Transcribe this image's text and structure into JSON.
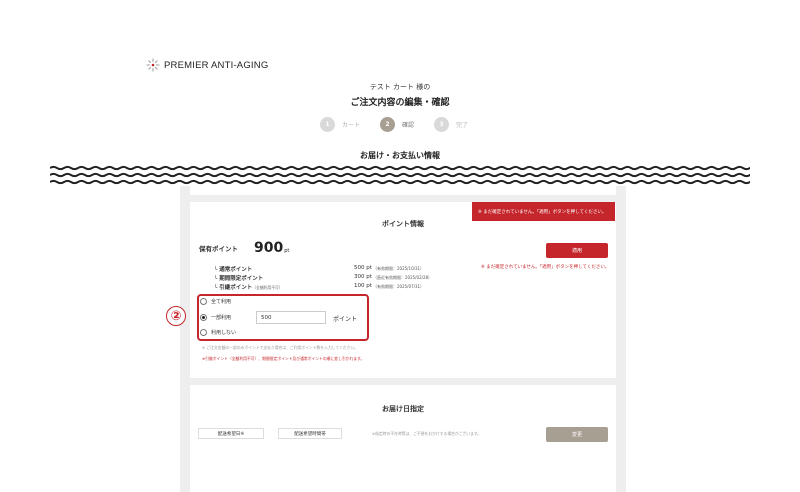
{
  "brand": {
    "logo_text": "PREMIER ANTI-AGING",
    "logo_icon": "sunburst-logo-icon"
  },
  "header": {
    "customer_line": "テスト カート 様の",
    "page_title": "ご注文内容の編集・確認"
  },
  "steps": [
    {
      "number": "1",
      "label": "カート",
      "active": false
    },
    {
      "number": "2",
      "label": "確認",
      "active": true
    },
    {
      "number": "3",
      "label": "完了",
      "active": false
    }
  ],
  "section_title": "お届け・お支払い情報",
  "points": {
    "title": "ポイント情報",
    "alert_banner": "※ まだ確定されていません。「適用」ボタンを押してください。",
    "held_label": "保有ポイント",
    "held_value": "900",
    "held_unit": "pt",
    "apply_label": "適用",
    "apply_note": "※ まだ確定されていません。「適用」ボタンを押してください。",
    "rows": [
      {
        "name": "└ 通常ポイント",
        "sub": "",
        "value": "500",
        "unit": "pt",
        "expiry": "（有効期限：2025/10/31）"
      },
      {
        "name": "└ 期間限定ポイント",
        "sub": "",
        "value": "300",
        "unit": "pt",
        "expiry": "（直近有効期限：2025/02/28）"
      },
      {
        "name": "└ 引継ポイント",
        "sub": "（全額利用不可）",
        "value": "100",
        "unit": "pt",
        "expiry": "（有効期限：2025/07/31）"
      }
    ],
    "options": [
      {
        "label": "全て利用",
        "checked": false
      },
      {
        "label": "一部利用",
        "checked": true
      },
      {
        "label": "利用しない",
        "checked": false
      }
    ],
    "amount_value": "500",
    "amount_unit": "ポイント",
    "annotation_number": "②",
    "note_gray": "※ ご注文金額の一部のみポイントで支払う場合は、ご利用ポイント数を入力してください。",
    "note_red": "※引継ポイント（全額利用不可）、期間限定ポイント及び通常ポイントの順に差し引かれます。"
  },
  "delivery": {
    "title": "お届け日指定",
    "date_field": "配送希望日※",
    "time_field": "配送希望時間帯",
    "note": "※指定時の不在時等は、ご不便をおかけする場合がございます。",
    "change_label": "変更"
  },
  "colors": {
    "accent_red": "#c5262b",
    "step_active": "#a89f93",
    "panel_bg": "#eeeeee"
  }
}
